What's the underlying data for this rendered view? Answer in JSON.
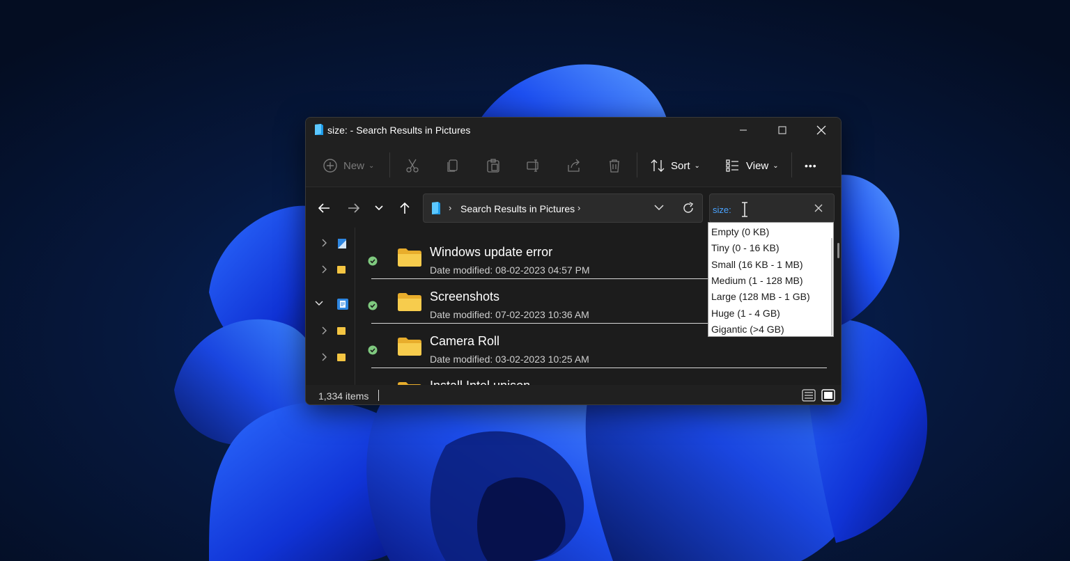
{
  "window": {
    "title": "size: - Search Results in Pictures"
  },
  "toolbar": {
    "new_label": "New",
    "sort_label": "Sort",
    "view_label": "View",
    "more_label": "•••"
  },
  "address": {
    "location": "Search Results in Pictures",
    "separator": "›"
  },
  "search": {
    "value": "size:"
  },
  "size_suggestions": [
    "Empty (0 KB)",
    "Tiny (0 - 16 KB)",
    "Small (16 KB - 1 MB)",
    "Medium (1 - 128 MB)",
    "Large (128 MB - 1 GB)",
    "Huge (1 - 4 GB)",
    "Gigantic (>4 GB)"
  ],
  "files": [
    {
      "name": "Windows update error",
      "date": "Date modified: 08-02-2023 04:57 PM"
    },
    {
      "name": "Screenshots",
      "date": "Date modified: 07-02-2023 10:36 AM"
    },
    {
      "name": "Camera Roll",
      "date": "Date modified: 03-02-2023 10:25 AM"
    },
    {
      "name": "Install Intel unison",
      "date": ""
    }
  ],
  "statusbar": {
    "item_count": "1,334 items"
  },
  "colors": {
    "accent": "#4aa3ff",
    "folder": "#f4c542",
    "synced": "#7fc97f"
  },
  "icons": {
    "title": "pictures-folder-icon",
    "sidebar": [
      "gallery-icon",
      "folder-icon",
      "documents-icon",
      "folder-icon",
      "folder-icon"
    ]
  }
}
